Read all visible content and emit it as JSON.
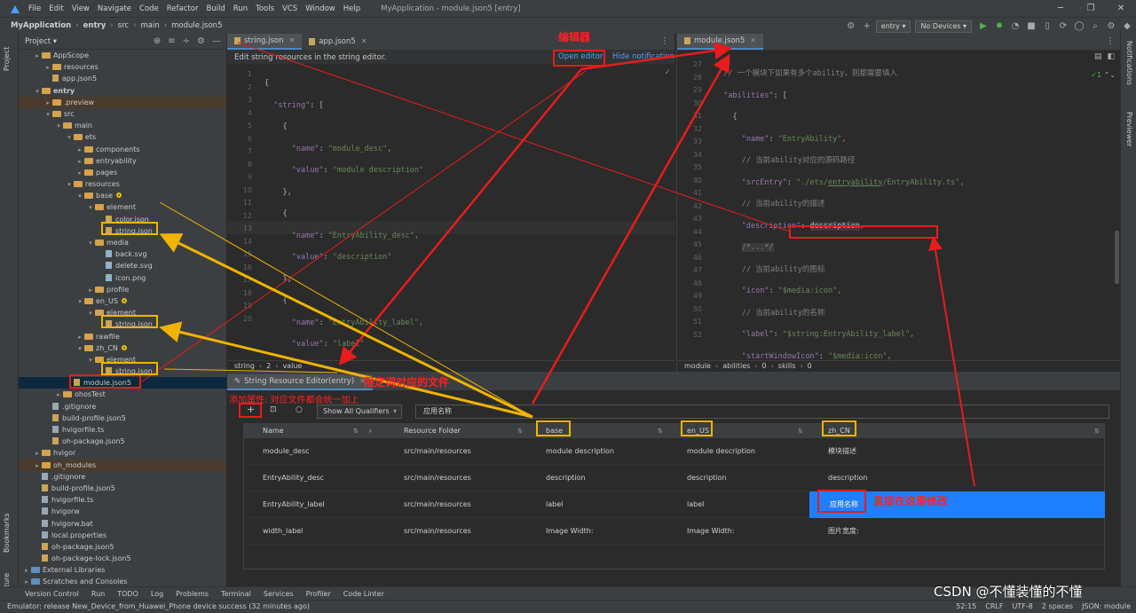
{
  "menubar": {
    "items": [
      "File",
      "Edit",
      "View",
      "Navigate",
      "Code",
      "Refactor",
      "Build",
      "Run",
      "Tools",
      "VCS",
      "Window",
      "Help"
    ],
    "window_title": "MyApplication - module.json5 [entry]"
  },
  "navbar": {
    "breadcrumbs": [
      "MyApplication",
      "entry",
      "src",
      "main",
      "module.json5"
    ],
    "module_select": "entry",
    "device_select": "No Devices"
  },
  "left_strip": [
    "Project",
    "Bookmarks",
    "Structure"
  ],
  "right_strip": [
    "Notifications",
    "Previewer"
  ],
  "project": {
    "title": "Project",
    "tree": [
      {
        "label": "AppScope",
        "level": 1,
        "type": "folder",
        "open": false
      },
      {
        "label": "resources",
        "level": 2,
        "type": "folder",
        "open": false
      },
      {
        "label": "app.json5",
        "level": 2,
        "type": "json"
      },
      {
        "label": "entry",
        "level": 1,
        "type": "folder",
        "open": true,
        "bold": true
      },
      {
        "label": ".preview",
        "level": 2,
        "type": "folder",
        "open": false,
        "hl": true
      },
      {
        "label": "src",
        "level": 2,
        "type": "folder",
        "open": true
      },
      {
        "label": "main",
        "level": 3,
        "type": "folder",
        "open": true
      },
      {
        "label": "ets",
        "level": 4,
        "type": "folder",
        "open": true
      },
      {
        "label": "components",
        "level": 5,
        "type": "folder",
        "open": false
      },
      {
        "label": "entryability",
        "level": 5,
        "type": "folder",
        "open": false
      },
      {
        "label": "pages",
        "level": 5,
        "type": "folder",
        "open": false
      },
      {
        "label": "resources",
        "level": 4,
        "type": "folder",
        "open": true
      },
      {
        "label": "base",
        "level": 5,
        "type": "folder",
        "open": true,
        "dot": true
      },
      {
        "label": "element",
        "level": 6,
        "type": "folder",
        "open": true
      },
      {
        "label": "color.json",
        "level": 7,
        "type": "json"
      },
      {
        "label": "string.json",
        "level": 7,
        "type": "json"
      },
      {
        "label": "media",
        "level": 6,
        "type": "folder",
        "open": true
      },
      {
        "label": "back.svg",
        "level": 7,
        "type": "img"
      },
      {
        "label": "delete.svg",
        "level": 7,
        "type": "img"
      },
      {
        "label": "icon.png",
        "level": 7,
        "type": "img"
      },
      {
        "label": "profile",
        "level": 6,
        "type": "folder",
        "open": false
      },
      {
        "label": "en_US",
        "level": 5,
        "type": "folder",
        "open": true,
        "dot": true
      },
      {
        "label": "element",
        "level": 6,
        "type": "folder",
        "open": true
      },
      {
        "label": "string.json",
        "level": 7,
        "type": "json"
      },
      {
        "label": "rawfile",
        "level": 5,
        "type": "folder",
        "open": false
      },
      {
        "label": "zh_CN",
        "level": 5,
        "type": "folder",
        "open": true,
        "dot": true
      },
      {
        "label": "element",
        "level": 6,
        "type": "folder",
        "open": true
      },
      {
        "label": "string.json",
        "level": 7,
        "type": "json"
      },
      {
        "label": "module.json5",
        "level": 4,
        "type": "json",
        "sel": true
      },
      {
        "label": "ohosTest",
        "level": 3,
        "type": "folder",
        "open": false
      },
      {
        "label": ".gitignore",
        "level": 2,
        "type": "file"
      },
      {
        "label": "build-profile.json5",
        "level": 2,
        "type": "json"
      },
      {
        "label": "hvigorfile.ts",
        "level": 2,
        "type": "file"
      },
      {
        "label": "oh-package.json5",
        "level": 2,
        "type": "json"
      },
      {
        "label": "hvigor",
        "level": 1,
        "type": "folder",
        "open": false
      },
      {
        "label": "oh_modules",
        "level": 1,
        "type": "folder",
        "open": false,
        "hl": true
      },
      {
        "label": ".gitignore",
        "level": 1,
        "type": "file"
      },
      {
        "label": "build-profile.json5",
        "level": 1,
        "type": "json"
      },
      {
        "label": "hvigorfile.ts",
        "level": 1,
        "type": "file"
      },
      {
        "label": "hvigorw",
        "level": 1,
        "type": "file"
      },
      {
        "label": "hvigorw.bat",
        "level": 1,
        "type": "file"
      },
      {
        "label": "local.properties",
        "level": 1,
        "type": "file"
      },
      {
        "label": "oh-package.json5",
        "level": 1,
        "type": "json"
      },
      {
        "label": "oh-package-lock.json5",
        "level": 1,
        "type": "json"
      },
      {
        "label": "External Libraries",
        "level": 0,
        "type": "lib",
        "open": false
      },
      {
        "label": "Scratches and Consoles",
        "level": 0,
        "type": "lib",
        "open": false
      }
    ]
  },
  "editor_left": {
    "tabs": [
      "string.json",
      "app.json5"
    ],
    "notice": "Edit string resources in the string editor.",
    "open_editor": "Open editor",
    "hide_notification": "Hide notification",
    "lines": [
      "1",
      "2",
      "3",
      "4",
      "5",
      "6",
      "7",
      "8",
      "9",
      "10",
      "11",
      "12",
      "13",
      "14",
      "15",
      "16",
      "17",
      "18",
      "19",
      "20"
    ],
    "status": [
      "string",
      "2",
      "value"
    ]
  },
  "editor_right": {
    "tabs": [
      "module.json5"
    ],
    "lines": [
      "27",
      "28",
      "29",
      "30",
      "31",
      "32",
      "33",
      "34",
      "35",
      "40",
      "41",
      "42",
      "43",
      "44",
      "45",
      "46",
      "47",
      "48",
      "49",
      "50",
      "51",
      "52"
    ],
    "status": [
      "module",
      "abilities",
      "0",
      "skills",
      "0"
    ],
    "inspection": "1"
  },
  "sre": {
    "tab": "String Resource Editor(entry)",
    "qualifiers": "Show All Qualifiers",
    "search": "应用名称",
    "columns": [
      "Name",
      "Resource Folder",
      "base",
      "en_US",
      "zh_CN"
    ],
    "rows": [
      [
        "module_desc",
        "src/main/resources",
        "module description",
        "module description",
        "模块描述"
      ],
      [
        "EntryAbility_desc",
        "src/main/resources",
        "description",
        "description",
        "description"
      ],
      [
        "EntryAbility_label",
        "src/main/resources",
        "label",
        "label",
        "应用名称"
      ],
      [
        "width_label",
        "src/main/resources",
        "Image Width:",
        "Image Width:",
        "图片宽度:"
      ]
    ]
  },
  "bottom_tools": [
    "Version Control",
    "Run",
    "TODO",
    "Log",
    "Problems",
    "Terminal",
    "Services",
    "Profiler",
    "Code Linter"
  ],
  "statusbar": {
    "message": "Emulator: release New_Device_from_Huawei_Phone device success (32 minutes ago)",
    "right": [
      "52:15",
      "CRLF",
      "UTF-8",
      "2 spaces",
      "JSON: module"
    ]
  },
  "annotations": {
    "editor": "编辑器",
    "qualifier_file": "限定词对应的文件",
    "add_attr": "添加属性: 对应文件都会统一加上",
    "edit_direct": "直接在这里修改"
  },
  "watermark": "CSDN @不懂装懂的不懂"
}
